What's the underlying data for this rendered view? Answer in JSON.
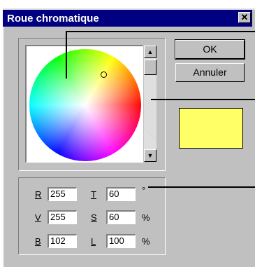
{
  "dialog": {
    "title": "Roue chromatique",
    "close_glyph": "✕"
  },
  "buttons": {
    "ok": "OK",
    "cancel": "Annuler"
  },
  "preview_color": "#ffff66",
  "scrollbar": {
    "up_glyph": "▲",
    "down_glyph": "▼"
  },
  "values": {
    "r_label": "R",
    "r_value": "255",
    "v_label": "V",
    "v_value": "255",
    "b_label": "B",
    "b_value": "102",
    "t_label": "T",
    "t_value": "60",
    "t_unit": "°",
    "s_label": "S",
    "s_value": "60",
    "s_unit": "%",
    "l_label": "L",
    "l_value": "100",
    "l_unit": "%"
  }
}
